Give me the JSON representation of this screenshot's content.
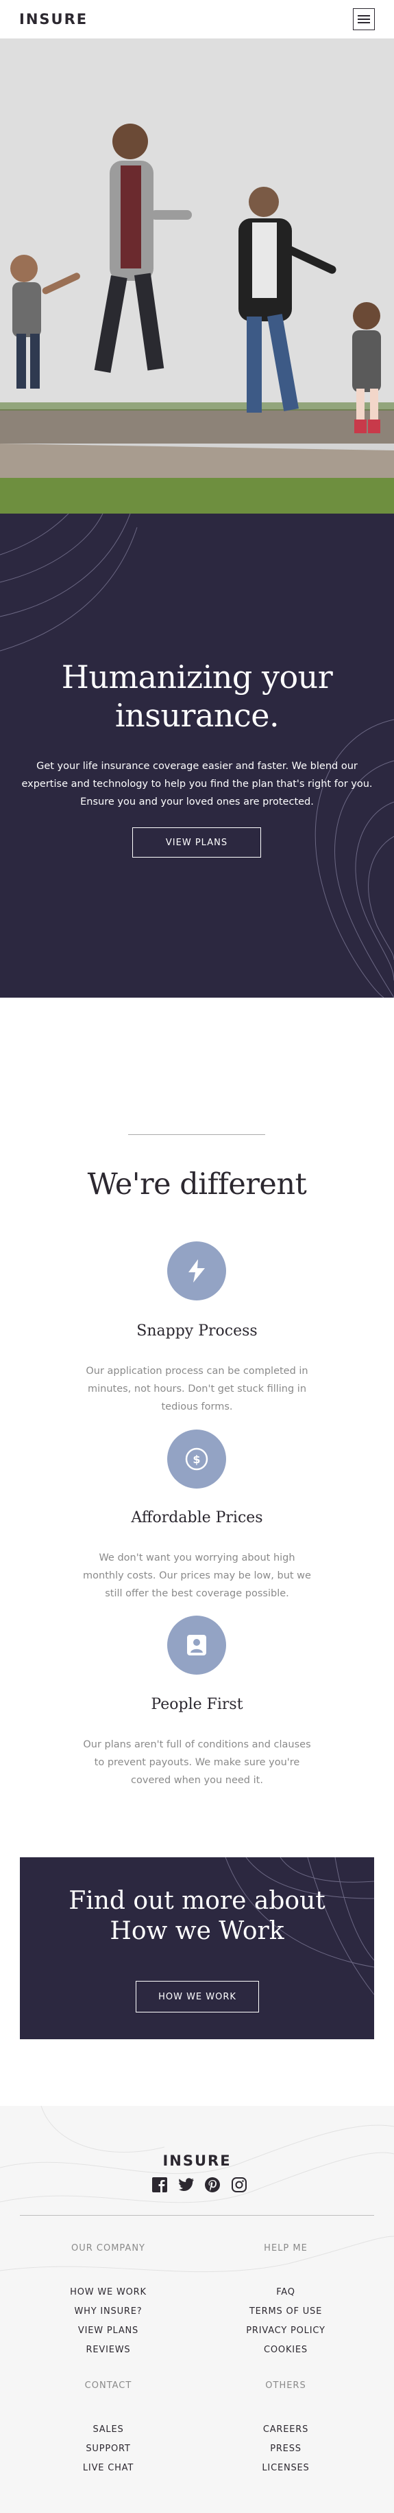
{
  "header": {
    "logo": "INSURE",
    "menu_icon": "hamburger-icon"
  },
  "hero": {
    "title_line1": "Humanizing your",
    "title_line2": "insurance.",
    "text": "Get your life insurance coverage easier and faster. We blend our expertise and technology to help you find the plan that's right for you. Ensure you and your loved ones are protected.",
    "button": "VIEW PLANS"
  },
  "different": {
    "title": "We're different",
    "features": [
      {
        "icon": "lightning-icon",
        "title": "Snappy Process",
        "text": "Our application process can be completed in minutes, not hours. Don't get stuck filling in tedious forms."
      },
      {
        "icon": "dollar-icon",
        "title": "Affordable Prices",
        "text": "We don't want you worrying about high monthly costs. Our prices may be low, but we still offer the best coverage possible."
      },
      {
        "icon": "person-icon",
        "title": "People First",
        "text": "Our plans aren't full of conditions and clauses to prevent payouts. We make sure you're covered when you need it."
      }
    ]
  },
  "cta": {
    "title_line1": "Find out more about",
    "title_line2": "How we Work",
    "button": "HOW WE WORK"
  },
  "footer": {
    "logo": "INSURE",
    "socials": [
      "facebook-icon",
      "twitter-icon",
      "pinterest-icon",
      "instagram-icon"
    ],
    "our_company": {
      "heading": "OUR COMPANY",
      "links": [
        "HOW WE WORK",
        "WHY INSURE?",
        "VIEW PLANS",
        "REVIEWS"
      ]
    },
    "help_me": {
      "heading": "HELP ME",
      "links": [
        "FAQ",
        "TERMS OF USE",
        "PRIVACY POLICY",
        "COOKIES"
      ]
    },
    "contact": {
      "heading": "CONTACT",
      "links": [
        "SALES",
        "SUPPORT",
        "LIVE CHAT"
      ]
    },
    "others": {
      "heading": "OTHERS",
      "links": [
        "CAREERS",
        "PRESS",
        "LICENSES"
      ]
    }
  },
  "colors": {
    "dark_violet": "#2C2840",
    "icon_blue": "#93A3C4",
    "text_gray": "#8a8a8a"
  }
}
